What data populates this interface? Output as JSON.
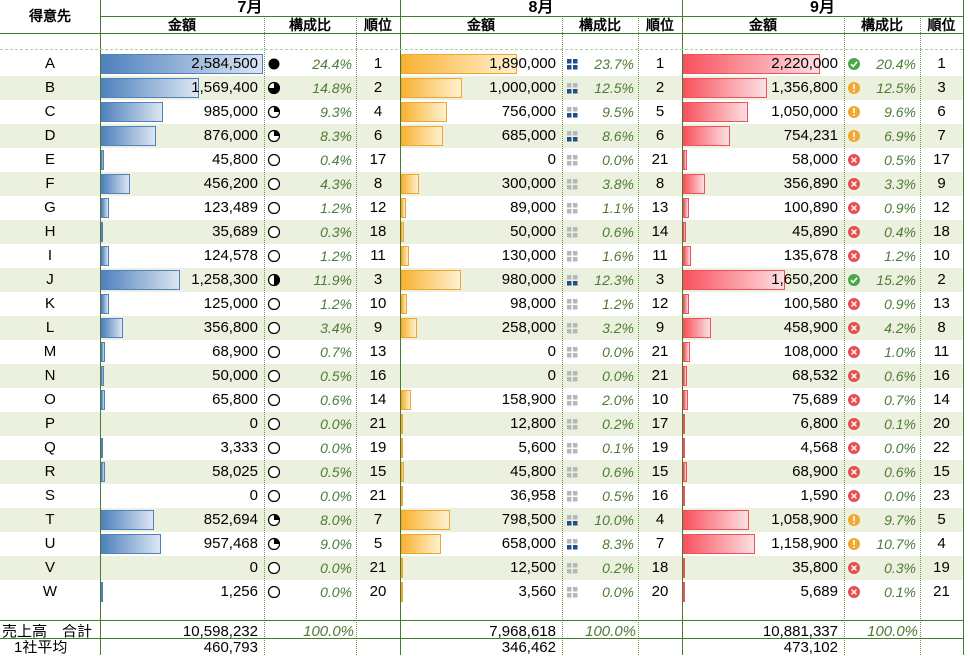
{
  "header": {
    "customer_label": "得意先",
    "months": [
      "7月",
      "8月",
      "9月"
    ],
    "col_amount": "金額",
    "col_ratio": "構成比",
    "col_rank": "順位"
  },
  "max_amount": 2584500,
  "colors": {
    "blue": "#4f81bd",
    "orange": "#f9b233",
    "red": "#f8525e",
    "row_alt": "#ebf1de",
    "ratio_text": "#4e7a33"
  },
  "rows": [
    {
      "name": "A",
      "jul": {
        "amount": "2,584,500",
        "value": 2584500,
        "ratio": "24.4%",
        "rank": "1",
        "icon": "pie-4"
      },
      "aug": {
        "amount": "1,890,000",
        "value": 1890000,
        "ratio": "23.7%",
        "rank": "1",
        "icon": "bars-4"
      },
      "sep": {
        "amount": "2,220,000",
        "value": 2220000,
        "ratio": "20.4%",
        "rank": "1",
        "icon": "check"
      }
    },
    {
      "name": "B",
      "jul": {
        "amount": "1,569,400",
        "value": 1569400,
        "ratio": "14.8%",
        "rank": "2",
        "icon": "pie-3"
      },
      "aug": {
        "amount": "1,000,000",
        "value": 1000000,
        "ratio": "12.5%",
        "rank": "2",
        "icon": "bars-2"
      },
      "sep": {
        "amount": "1,356,800",
        "value": 1356800,
        "ratio": "12.5%",
        "rank": "3",
        "icon": "warn"
      }
    },
    {
      "name": "C",
      "jul": {
        "amount": "985,000",
        "value": 985000,
        "ratio": "9.3%",
        "rank": "4",
        "icon": "pie-1"
      },
      "aug": {
        "amount": "756,000",
        "value": 756000,
        "ratio": "9.5%",
        "rank": "5",
        "icon": "bars-2"
      },
      "sep": {
        "amount": "1,050,000",
        "value": 1050000,
        "ratio": "9.6%",
        "rank": "6",
        "icon": "warn"
      }
    },
    {
      "name": "D",
      "jul": {
        "amount": "876,000",
        "value": 876000,
        "ratio": "8.3%",
        "rank": "6",
        "icon": "pie-1"
      },
      "aug": {
        "amount": "685,000",
        "value": 685000,
        "ratio": "8.6%",
        "rank": "6",
        "icon": "bars-2"
      },
      "sep": {
        "amount": "754,231",
        "value": 754231,
        "ratio": "6.9%",
        "rank": "7",
        "icon": "warn"
      }
    },
    {
      "name": "E",
      "jul": {
        "amount": "45,800",
        "value": 45800,
        "ratio": "0.4%",
        "rank": "17",
        "icon": "pie-0"
      },
      "aug": {
        "amount": "0",
        "value": 0,
        "ratio": "0.0%",
        "rank": "21",
        "icon": "bars-0"
      },
      "sep": {
        "amount": "58,000",
        "value": 58000,
        "ratio": "0.5%",
        "rank": "17",
        "icon": "cross"
      }
    },
    {
      "name": "F",
      "jul": {
        "amount": "456,200",
        "value": 456200,
        "ratio": "4.3%",
        "rank": "8",
        "icon": "pie-0"
      },
      "aug": {
        "amount": "300,000",
        "value": 300000,
        "ratio": "3.8%",
        "rank": "8",
        "icon": "bars-0"
      },
      "sep": {
        "amount": "356,890",
        "value": 356890,
        "ratio": "3.3%",
        "rank": "9",
        "icon": "cross"
      }
    },
    {
      "name": "G",
      "jul": {
        "amount": "123,489",
        "value": 123489,
        "ratio": "1.2%",
        "rank": "12",
        "icon": "pie-0"
      },
      "aug": {
        "amount": "89,000",
        "value": 89000,
        "ratio": "1.1%",
        "rank": "13",
        "icon": "bars-0"
      },
      "sep": {
        "amount": "100,890",
        "value": 100890,
        "ratio": "0.9%",
        "rank": "12",
        "icon": "cross"
      }
    },
    {
      "name": "H",
      "jul": {
        "amount": "35,689",
        "value": 35689,
        "ratio": "0.3%",
        "rank": "18",
        "icon": "pie-0"
      },
      "aug": {
        "amount": "50,000",
        "value": 50000,
        "ratio": "0.6%",
        "rank": "14",
        "icon": "bars-0"
      },
      "sep": {
        "amount": "45,890",
        "value": 45890,
        "ratio": "0.4%",
        "rank": "18",
        "icon": "cross"
      }
    },
    {
      "name": "I",
      "jul": {
        "amount": "124,578",
        "value": 124578,
        "ratio": "1.2%",
        "rank": "11",
        "icon": "pie-0"
      },
      "aug": {
        "amount": "130,000",
        "value": 130000,
        "ratio": "1.6%",
        "rank": "11",
        "icon": "bars-0"
      },
      "sep": {
        "amount": "135,678",
        "value": 135678,
        "ratio": "1.2%",
        "rank": "10",
        "icon": "cross"
      }
    },
    {
      "name": "J",
      "jul": {
        "amount": "1,258,300",
        "value": 1258300,
        "ratio": "11.9%",
        "rank": "3",
        "icon": "pie-2"
      },
      "aug": {
        "amount": "980,000",
        "value": 980000,
        "ratio": "12.3%",
        "rank": "3",
        "icon": "bars-2"
      },
      "sep": {
        "amount": "1,650,200",
        "value": 1650200,
        "ratio": "15.2%",
        "rank": "2",
        "icon": "check"
      }
    },
    {
      "name": "K",
      "jul": {
        "amount": "125,000",
        "value": 125000,
        "ratio": "1.2%",
        "rank": "10",
        "icon": "pie-0"
      },
      "aug": {
        "amount": "98,000",
        "value": 98000,
        "ratio": "1.2%",
        "rank": "12",
        "icon": "bars-0"
      },
      "sep": {
        "amount": "100,580",
        "value": 100580,
        "ratio": "0.9%",
        "rank": "13",
        "icon": "cross"
      }
    },
    {
      "name": "L",
      "jul": {
        "amount": "356,800",
        "value": 356800,
        "ratio": "3.4%",
        "rank": "9",
        "icon": "pie-0"
      },
      "aug": {
        "amount": "258,000",
        "value": 258000,
        "ratio": "3.2%",
        "rank": "9",
        "icon": "bars-0"
      },
      "sep": {
        "amount": "458,900",
        "value": 458900,
        "ratio": "4.2%",
        "rank": "8",
        "icon": "cross"
      }
    },
    {
      "name": "M",
      "jul": {
        "amount": "68,900",
        "value": 68900,
        "ratio": "0.7%",
        "rank": "13",
        "icon": "pie-0"
      },
      "aug": {
        "amount": "0",
        "value": 0,
        "ratio": "0.0%",
        "rank": "21",
        "icon": "bars-0"
      },
      "sep": {
        "amount": "108,000",
        "value": 108000,
        "ratio": "1.0%",
        "rank": "11",
        "icon": "cross"
      }
    },
    {
      "name": "N",
      "jul": {
        "amount": "50,000",
        "value": 50000,
        "ratio": "0.5%",
        "rank": "16",
        "icon": "pie-0"
      },
      "aug": {
        "amount": "0",
        "value": 0,
        "ratio": "0.0%",
        "rank": "21",
        "icon": "bars-0"
      },
      "sep": {
        "amount": "68,532",
        "value": 68532,
        "ratio": "0.6%",
        "rank": "16",
        "icon": "cross"
      }
    },
    {
      "name": "O",
      "jul": {
        "amount": "65,800",
        "value": 65800,
        "ratio": "0.6%",
        "rank": "14",
        "icon": "pie-0"
      },
      "aug": {
        "amount": "158,900",
        "value": 158900,
        "ratio": "2.0%",
        "rank": "10",
        "icon": "bars-0"
      },
      "sep": {
        "amount": "75,689",
        "value": 75689,
        "ratio": "0.7%",
        "rank": "14",
        "icon": "cross"
      }
    },
    {
      "name": "P",
      "jul": {
        "amount": "0",
        "value": 0,
        "ratio": "0.0%",
        "rank": "21",
        "icon": "pie-0"
      },
      "aug": {
        "amount": "12,800",
        "value": 12800,
        "ratio": "0.2%",
        "rank": "17",
        "icon": "bars-0"
      },
      "sep": {
        "amount": "6,800",
        "value": 6800,
        "ratio": "0.1%",
        "rank": "20",
        "icon": "cross"
      }
    },
    {
      "name": "Q",
      "jul": {
        "amount": "3,333",
        "value": 3333,
        "ratio": "0.0%",
        "rank": "19",
        "icon": "pie-0"
      },
      "aug": {
        "amount": "5,600",
        "value": 5600,
        "ratio": "0.1%",
        "rank": "19",
        "icon": "bars-0"
      },
      "sep": {
        "amount": "4,568",
        "value": 4568,
        "ratio": "0.0%",
        "rank": "22",
        "icon": "cross"
      }
    },
    {
      "name": "R",
      "jul": {
        "amount": "58,025",
        "value": 58025,
        "ratio": "0.5%",
        "rank": "15",
        "icon": "pie-0"
      },
      "aug": {
        "amount": "45,800",
        "value": 45800,
        "ratio": "0.6%",
        "rank": "15",
        "icon": "bars-0"
      },
      "sep": {
        "amount": "68,900",
        "value": 68900,
        "ratio": "0.6%",
        "rank": "15",
        "icon": "cross"
      }
    },
    {
      "name": "S",
      "jul": {
        "amount": "0",
        "value": 0,
        "ratio": "0.0%",
        "rank": "21",
        "icon": "pie-0"
      },
      "aug": {
        "amount": "36,958",
        "value": 36958,
        "ratio": "0.5%",
        "rank": "16",
        "icon": "bars-0"
      },
      "sep": {
        "amount": "1,590",
        "value": 1590,
        "ratio": "0.0%",
        "rank": "23",
        "icon": "cross"
      }
    },
    {
      "name": "T",
      "jul": {
        "amount": "852,694",
        "value": 852694,
        "ratio": "8.0%",
        "rank": "7",
        "icon": "pie-1"
      },
      "aug": {
        "amount": "798,500",
        "value": 798500,
        "ratio": "10.0%",
        "rank": "4",
        "icon": "bars-2"
      },
      "sep": {
        "amount": "1,058,900",
        "value": 1058900,
        "ratio": "9.7%",
        "rank": "5",
        "icon": "warn"
      }
    },
    {
      "name": "U",
      "jul": {
        "amount": "957,468",
        "value": 957468,
        "ratio": "9.0%",
        "rank": "5",
        "icon": "pie-1"
      },
      "aug": {
        "amount": "658,000",
        "value": 658000,
        "ratio": "8.3%",
        "rank": "7",
        "icon": "bars-2"
      },
      "sep": {
        "amount": "1,158,900",
        "value": 1158900,
        "ratio": "10.7%",
        "rank": "4",
        "icon": "warn"
      }
    },
    {
      "name": "V",
      "jul": {
        "amount": "0",
        "value": 0,
        "ratio": "0.0%",
        "rank": "21",
        "icon": "pie-0"
      },
      "aug": {
        "amount": "12,500",
        "value": 12500,
        "ratio": "0.2%",
        "rank": "18",
        "icon": "bars-0"
      },
      "sep": {
        "amount": "35,800",
        "value": 35800,
        "ratio": "0.3%",
        "rank": "19",
        "icon": "cross"
      }
    },
    {
      "name": "W",
      "jul": {
        "amount": "1,256",
        "value": 1256,
        "ratio": "0.0%",
        "rank": "20",
        "icon": "pie-0"
      },
      "aug": {
        "amount": "3,560",
        "value": 3560,
        "ratio": "0.0%",
        "rank": "20",
        "icon": "bars-0"
      },
      "sep": {
        "amount": "5,689",
        "value": 5689,
        "ratio": "0.1%",
        "rank": "21",
        "icon": "cross"
      }
    }
  ],
  "footer": {
    "total_label": "売上高　合計",
    "avg_label": "1社平均",
    "total": {
      "jul": "10,598,232",
      "aug": "7,968,618",
      "sep": "10,881,337"
    },
    "total_ratio": {
      "jul": "100.0%",
      "aug": "100.0%",
      "sep": "100.0%"
    },
    "avg": {
      "jul": "460,793",
      "aug": "346,462",
      "sep": "473,102"
    }
  }
}
